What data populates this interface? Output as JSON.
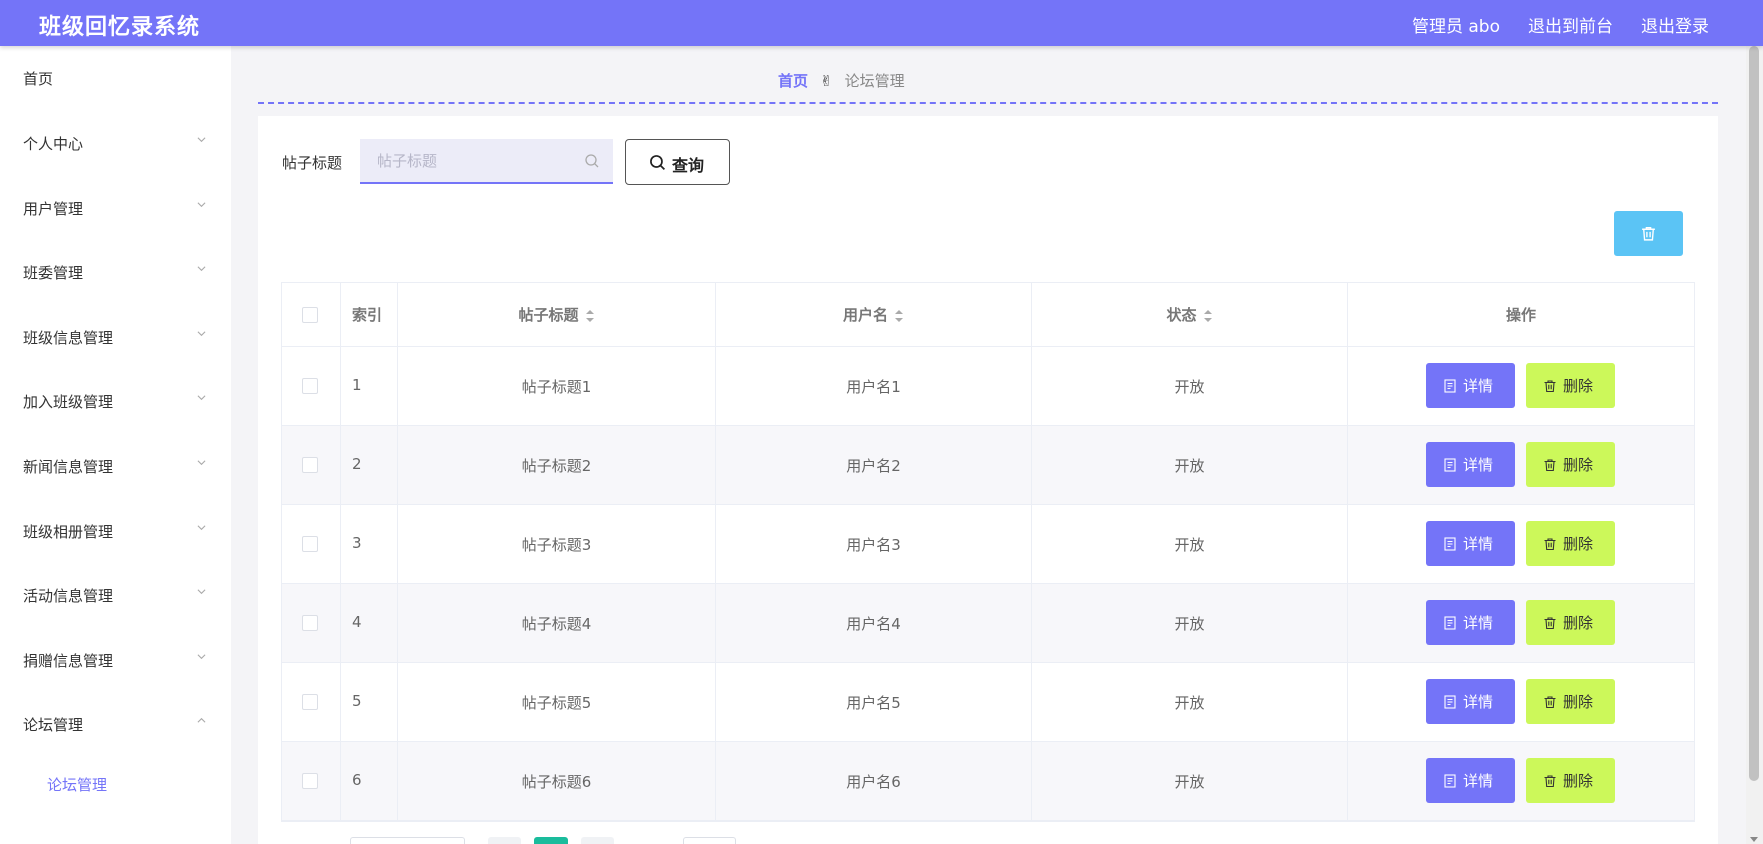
{
  "header": {
    "app_title": "班级回忆录系统",
    "links": [
      "管理员 abo",
      "退出到前台",
      "退出登录"
    ]
  },
  "sidebar": {
    "items": [
      {
        "label": "首页",
        "has_chevron": false
      },
      {
        "label": "个人中心",
        "has_chevron": true
      },
      {
        "label": "用户管理",
        "has_chevron": true
      },
      {
        "label": "班委管理",
        "has_chevron": true
      },
      {
        "label": "班级信息管理",
        "has_chevron": true
      },
      {
        "label": "加入班级管理",
        "has_chevron": true
      },
      {
        "label": "新闻信息管理",
        "has_chevron": true
      },
      {
        "label": "班级相册管理",
        "has_chevron": true
      },
      {
        "label": "活动信息管理",
        "has_chevron": true
      },
      {
        "label": "捐赠信息管理",
        "has_chevron": true
      },
      {
        "label": "论坛管理",
        "has_chevron": true,
        "expanded": true
      }
    ],
    "active_sub_item": "论坛管理"
  },
  "breadcrumb": {
    "home": "首页",
    "current": "论坛管理"
  },
  "search": {
    "label": "帖子标题",
    "placeholder": "帖子标题",
    "value": "",
    "button_label": "查询"
  },
  "table": {
    "headers": {
      "index": "索引",
      "title": "帖子标题",
      "user": "用户名",
      "status": "状态",
      "actions": "操作"
    },
    "rows": [
      {
        "index": "1",
        "title": "帖子标题1",
        "user": "用户名1",
        "status": "开放"
      },
      {
        "index": "2",
        "title": "帖子标题2",
        "user": "用户名2",
        "status": "开放"
      },
      {
        "index": "3",
        "title": "帖子标题3",
        "user": "用户名3",
        "status": "开放"
      },
      {
        "index": "4",
        "title": "帖子标题4",
        "user": "用户名4",
        "status": "开放"
      },
      {
        "index": "5",
        "title": "帖子标题5",
        "user": "用户名5",
        "status": "开放"
      },
      {
        "index": "6",
        "title": "帖子标题6",
        "user": "用户名6",
        "status": "开放"
      }
    ],
    "detail_label": "详情",
    "delete_label": "删除"
  },
  "colors": {
    "primary": "#7474f8",
    "delete_button": "#ccf85a",
    "batch_delete": "#5bc4f5",
    "pager_active": "#1abc9c"
  }
}
